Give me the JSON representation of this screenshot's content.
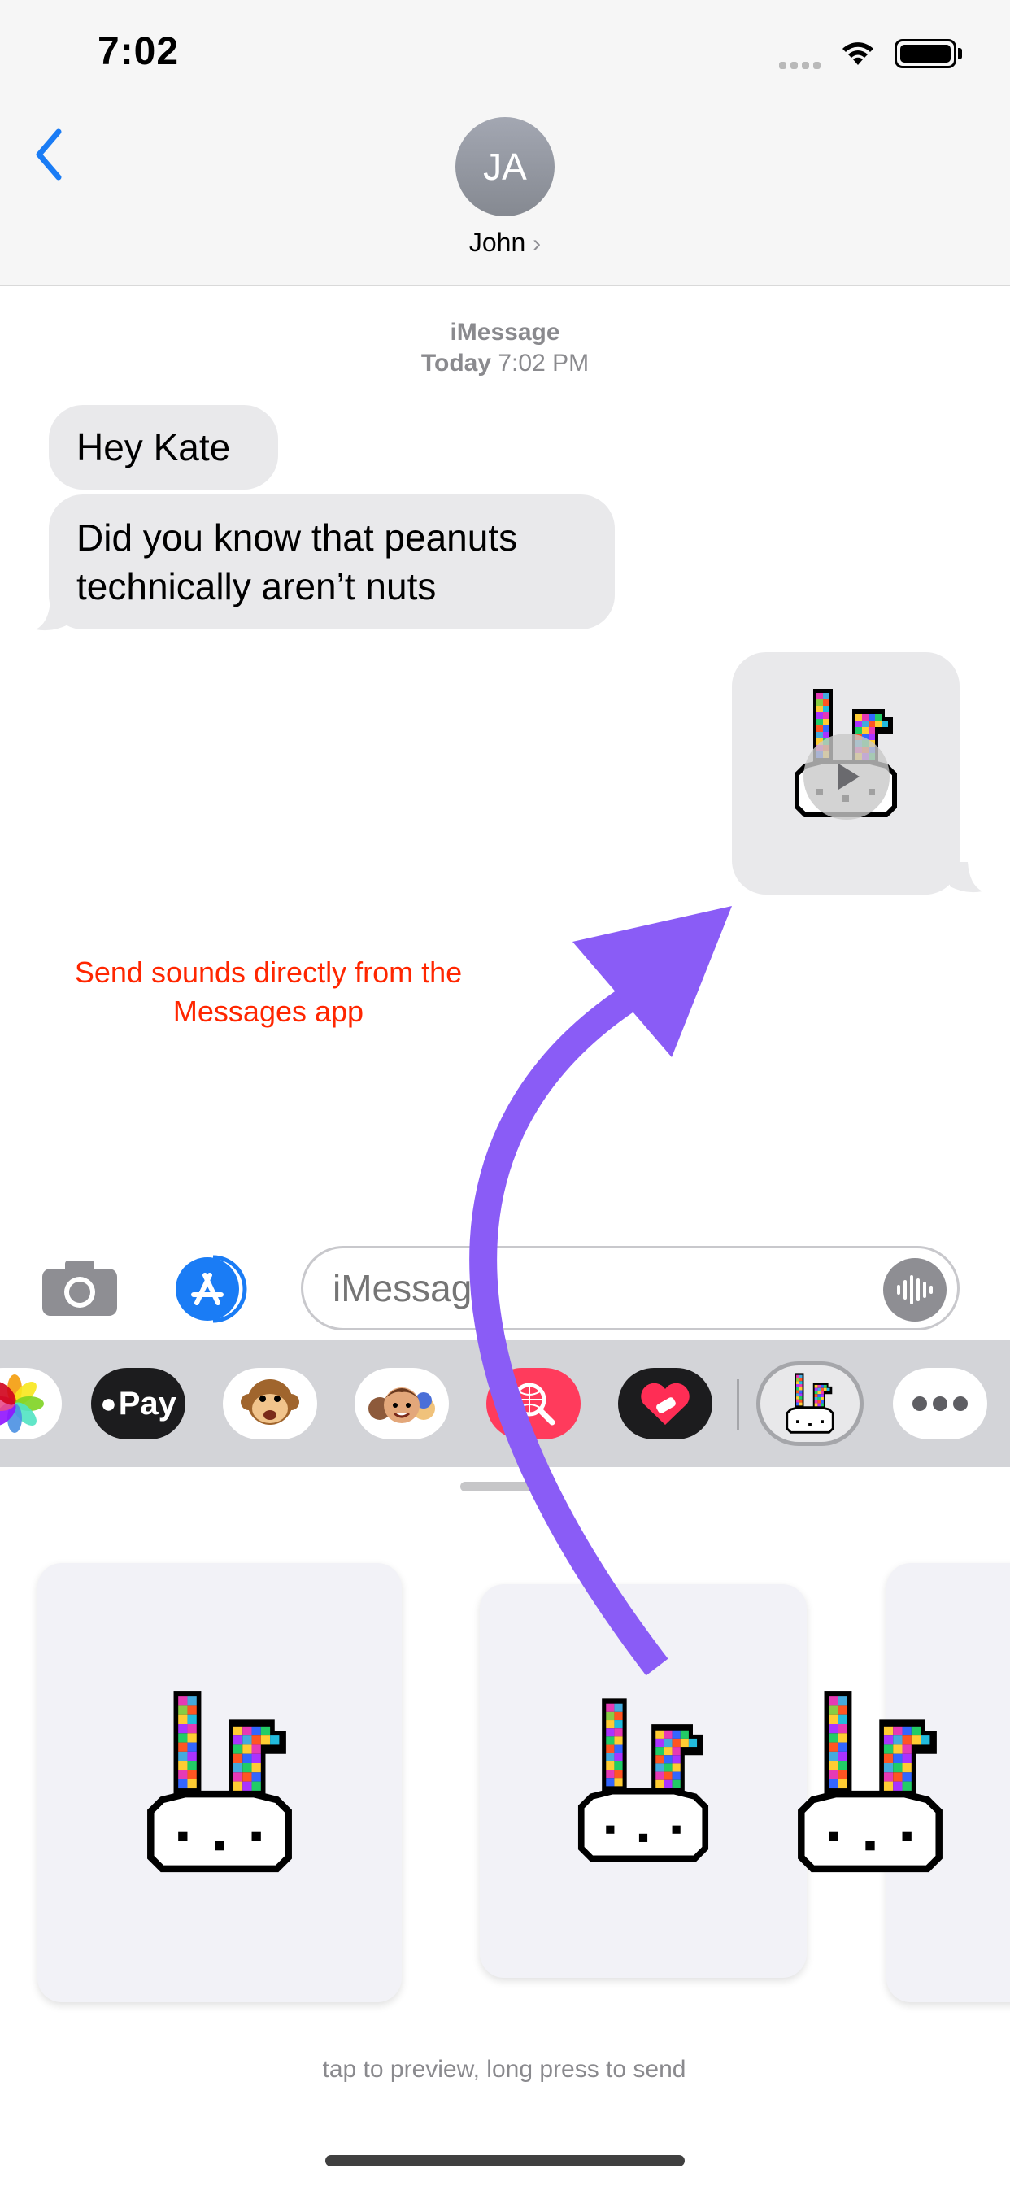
{
  "status_bar": {
    "time": "7:02"
  },
  "header": {
    "avatar_initials": "JA",
    "contact_name": "John",
    "chevron": "›"
  },
  "thread": {
    "service": "iMessage",
    "date_label": "Today",
    "time": "7:02 PM",
    "messages": [
      {
        "direction": "incoming",
        "text": "Hey Kate"
      },
      {
        "direction": "incoming",
        "text": "Did you know that peanuts technically aren’t nuts"
      },
      {
        "direction": "outgoing",
        "type": "sound-sticker",
        "icon": "pixel-bunny"
      }
    ]
  },
  "annotation": {
    "caption": "Send sounds directly from the Messages app",
    "caption_color": "#ff2600",
    "arrow_color": "#8a5cf6"
  },
  "input": {
    "placeholder": "iMessage"
  },
  "app_drawer": {
    "apps": [
      {
        "name": "photos-app-icon"
      },
      {
        "name": "apple-pay-app-icon",
        "label": "Pay"
      },
      {
        "name": "animoji-app-icon"
      },
      {
        "name": "memoji-app-icon"
      },
      {
        "name": "search-images-app-icon"
      },
      {
        "name": "heart-sticker-app-icon"
      },
      {
        "name": "bunny-sounds-app-icon",
        "selected": true
      },
      {
        "name": "more-apps-icon"
      }
    ]
  },
  "sticker_panel": {
    "hint": "tap to preview, long press to send",
    "stickers": [
      "pixel-bunny",
      "pixel-bunny",
      "pixel-bunny"
    ]
  }
}
